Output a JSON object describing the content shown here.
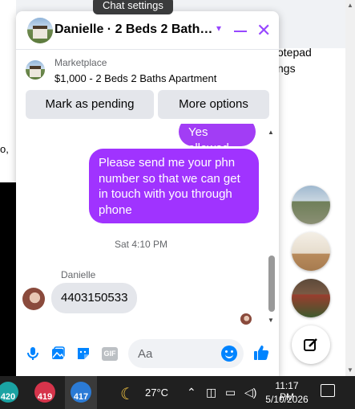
{
  "background": {
    "left_fragments": [
      "o,"
    ],
    "right_texts": [
      "otepad",
      "ngs"
    ]
  },
  "tooltip": "Chat settings",
  "chat": {
    "header": {
      "title": "Danielle · 2 Beds 2 Baths A...",
      "icons": [
        "chevron-down-icon",
        "minimize-icon",
        "close-icon"
      ]
    },
    "marketplace": {
      "label": "Marketplace",
      "listing": "$1,000 - 2 Beds 2 Baths Apartment"
    },
    "buttons": {
      "mark_pending": "Mark as pending",
      "more_options": "More options"
    },
    "messages": {
      "outgoing_1": "Yes allowed",
      "outgoing_2": "Please send me your phn number so that we can get in touch with you through phone",
      "time_separator": "Sat 4:10 PM",
      "sender": "Danielle",
      "incoming_1": "4403150533"
    },
    "composer": {
      "placeholder": "Aa",
      "gif_label": "GIF",
      "icons": [
        "microphone-icon",
        "photo-icon",
        "sticker-icon",
        "gif-icon",
        "emoji-icon",
        "like-icon"
      ]
    },
    "colors": {
      "accent": "#9747ff",
      "outgoing_bubble": "#a033ff",
      "incoming_bubble": "#e4e6eb"
    }
  },
  "chat_heads": [
    "chathead-house-1",
    "chathead-house-2",
    "chathead-house-3",
    "new-message-icon"
  ],
  "taskbar": {
    "apps": [
      {
        "label": "420",
        "color": "#1aa3a3"
      },
      {
        "label": "419",
        "color": "#d6344b"
      },
      {
        "label": "417",
        "color": "#2b7bd6"
      }
    ],
    "temperature": "27°C",
    "time": "11:17 PM",
    "date": "5/10/2026"
  }
}
